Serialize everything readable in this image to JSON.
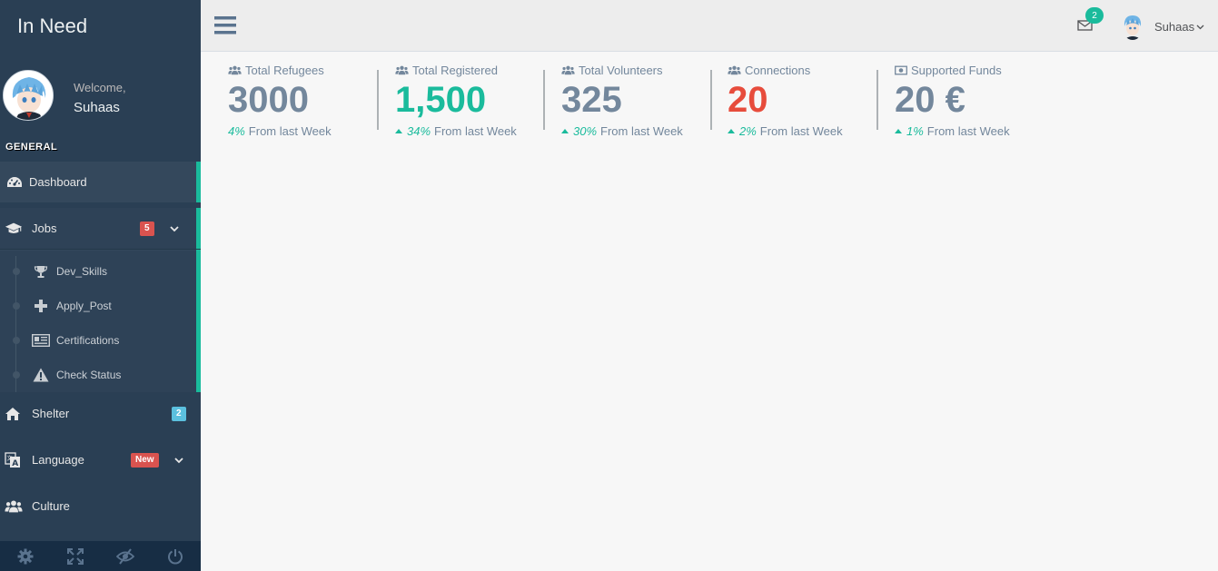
{
  "sidebar": {
    "brand": "In Need",
    "profile": {
      "welcome": "Welcome,",
      "name": "Suhaas"
    },
    "section": "GENERAL",
    "items": [
      {
        "label": "Dashboard",
        "icon": "dashboard-icon"
      },
      {
        "label": "Jobs",
        "icon": "graduation-cap-icon",
        "badge": "5"
      },
      {
        "label": "Shelter",
        "icon": "home-icon",
        "badge": "2"
      },
      {
        "label": "Language",
        "icon": "translate-icon",
        "badge": "New"
      },
      {
        "label": "Culture",
        "icon": "users-icon"
      }
    ],
    "jobs_sub": [
      {
        "label": "Dev_Skills",
        "icon": "trophy-icon"
      },
      {
        "label": "Apply_Post",
        "icon": "plus-icon"
      },
      {
        "label": "Certifications",
        "icon": "newspaper-icon"
      },
      {
        "label": "Check Status",
        "icon": "warning-icon"
      }
    ],
    "footer": [
      "settings-icon",
      "fullscreen-icon",
      "eye-slash-icon",
      "power-icon"
    ]
  },
  "topnav": {
    "mail_count": "2",
    "user_name": "Suhaas"
  },
  "stats": [
    {
      "title": "Total Refugees",
      "value": "3000",
      "pct": "4%",
      "suffix": "From last Week",
      "icon": "users-icon"
    },
    {
      "title": "Total Registered",
      "value": "1,500",
      "pct": "34%",
      "suffix": "From last Week",
      "icon": "users-icon"
    },
    {
      "title": "Total Volunteers",
      "value": "325",
      "pct": "30%",
      "suffix": "From last Week",
      "icon": "users-icon"
    },
    {
      "title": "Connections",
      "value": "20",
      "pct": "2%",
      "suffix": "From last Week",
      "icon": "users-icon"
    },
    {
      "title": "Supported Funds",
      "value": "20 €",
      "pct": "1%",
      "suffix": "From last Week",
      "icon": "money-icon"
    }
  ],
  "colors": {
    "sidebar": "#2A3F54",
    "accent": "#1ABB9C",
    "danger": "#E74C3C",
    "text": "#73879C"
  }
}
